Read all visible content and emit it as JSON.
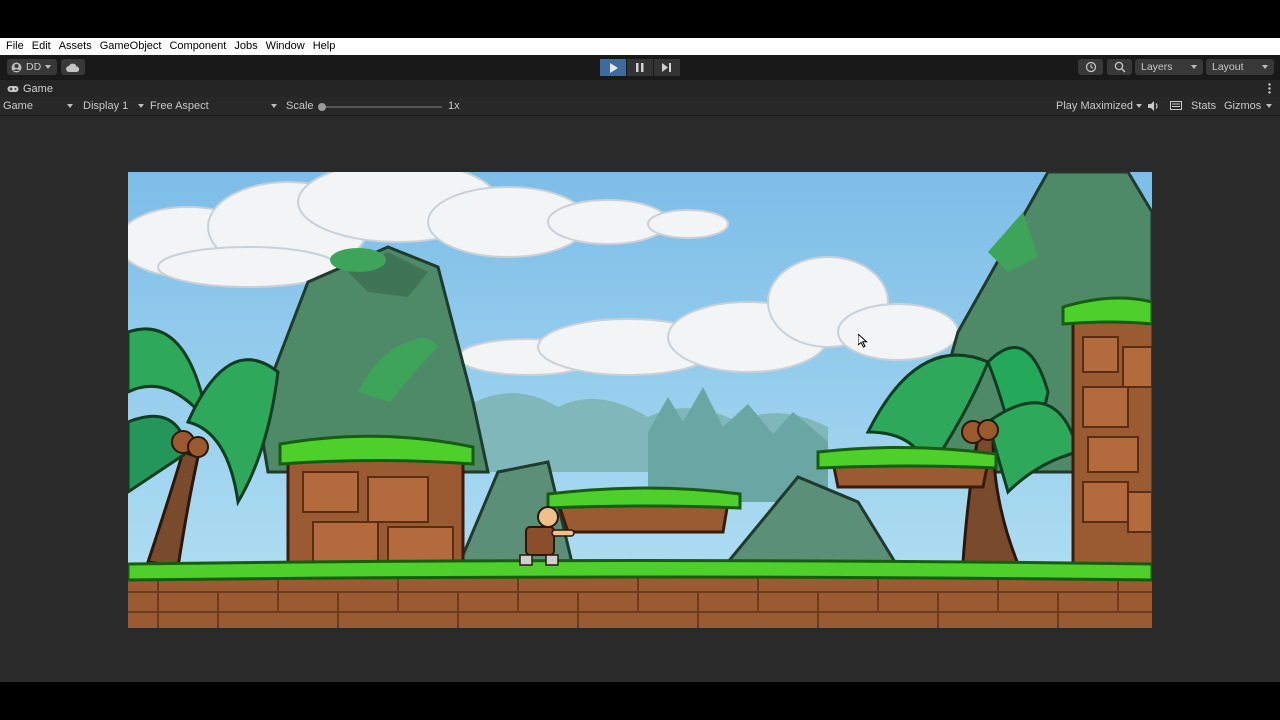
{
  "menu": [
    "File",
    "Edit",
    "Assets",
    "GameObject",
    "Component",
    "Jobs",
    "Window",
    "Help"
  ],
  "toolbar": {
    "account_label": "DD",
    "layers_label": "Layers",
    "layout_label": "Layout"
  },
  "tab": {
    "title": "Game"
  },
  "gamebar": {
    "mode": "Game",
    "display": "Display 1",
    "aspect": "Free Aspect",
    "scale_label": "Scale",
    "scale_value": "1x",
    "play_mode": "Play Maximized",
    "stats": "Stats",
    "gizmos": "Gizmos"
  },
  "colors": {
    "play_active": "#3e6aa0",
    "sky": "#8ecbef",
    "grass": "#4fcf2c",
    "dirt": "#9a5b33"
  }
}
